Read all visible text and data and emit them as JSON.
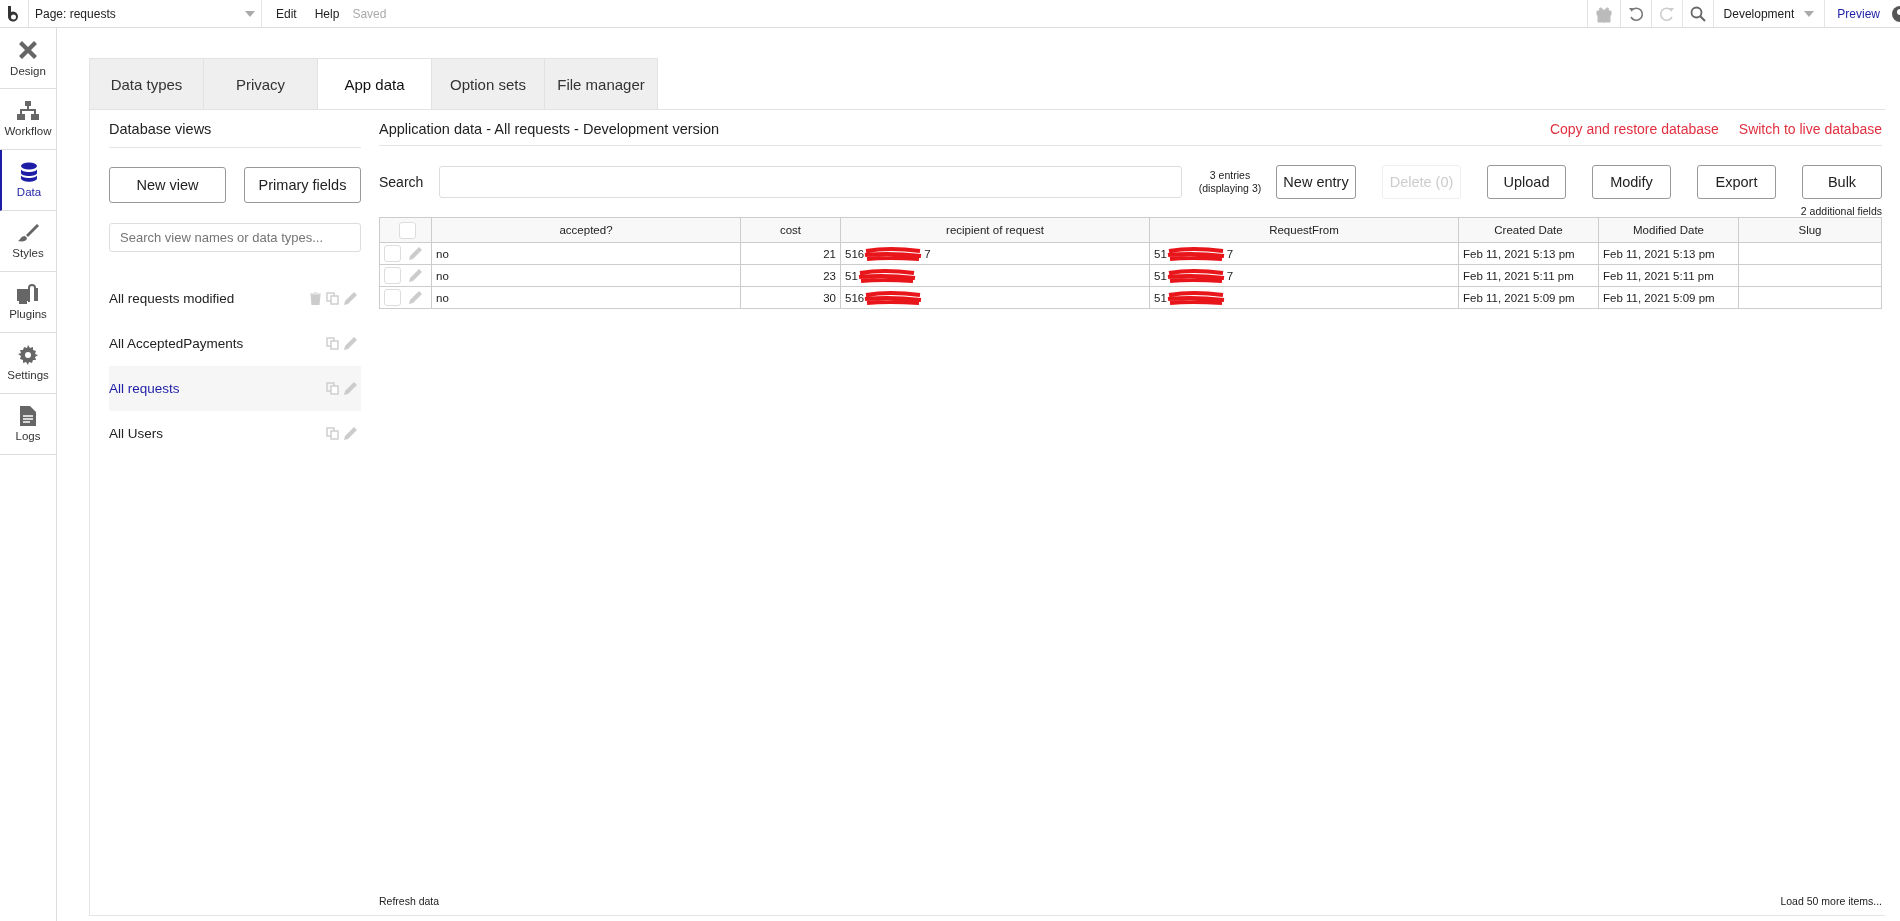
{
  "topbar": {
    "page": "Page: requests",
    "menu": [
      "Edit",
      "Help"
    ],
    "status": "Saved",
    "env": "Development",
    "preview": "Preview"
  },
  "sidebar": {
    "items": [
      {
        "label": "Design",
        "selected": false
      },
      {
        "label": "Workflow",
        "selected": false
      },
      {
        "label": "Data",
        "selected": true
      },
      {
        "label": "Styles",
        "selected": false
      },
      {
        "label": "Plugins",
        "selected": false
      },
      {
        "label": "Settings",
        "selected": false
      },
      {
        "label": "Logs",
        "selected": false
      }
    ]
  },
  "tabs": [
    {
      "label": "Data types",
      "selected": false
    },
    {
      "label": "Privacy",
      "selected": false
    },
    {
      "label": "App data",
      "selected": true
    },
    {
      "label": "Option sets",
      "selected": false
    },
    {
      "label": "File manager",
      "selected": false
    }
  ],
  "views": {
    "title": "Database views",
    "buttons": [
      "New view",
      "Primary fields"
    ],
    "search_placeholder": "Search view names or data types...",
    "items": [
      {
        "label": "All requests modified",
        "selected": false,
        "deletable": true
      },
      {
        "label": "All AcceptedPayments",
        "selected": false,
        "deletable": false
      },
      {
        "label": "All requests",
        "selected": true,
        "deletable": false
      },
      {
        "label": "All Users",
        "selected": false,
        "deletable": false
      }
    ]
  },
  "data": {
    "title": "Application data - All requests - Development version",
    "links": [
      "Copy and restore database",
      "Switch to live database"
    ],
    "search_label": "Search",
    "entries": [
      "3 entries",
      "(displaying 3)"
    ],
    "buttons": [
      {
        "label": "New entry",
        "disabled": false
      },
      {
        "label": "Delete (0)",
        "disabled": true
      },
      {
        "label": "Upload",
        "disabled": false
      },
      {
        "label": "Modify",
        "disabled": false
      },
      {
        "label": "Export",
        "disabled": false
      },
      {
        "label": "Bulk",
        "disabled": false
      }
    ],
    "additional": "2 additional fields",
    "select_all_checked": false,
    "columns": [
      "accepted?",
      "cost",
      "recipient of request",
      "RequestFrom",
      "Created Date",
      "Modified Date",
      "Slug"
    ],
    "rows": [
      {
        "checked": false,
        "accepted": "no",
        "cost": "21",
        "recipient": {
          "start": "516",
          "end": "7"
        },
        "from": {
          "start": "51",
          "end": "7"
        },
        "created": "Feb 11, 2021 5:13 pm",
        "modified": "Feb 11, 2021 5:13 pm"
      },
      {
        "checked": false,
        "accepted": "no",
        "cost": "23",
        "recipient": {
          "start": "51"
        },
        "from": {
          "start": "51",
          "end": "7"
        },
        "created": "Feb 11, 2021 5:11 pm",
        "modified": "Feb 11, 2021 5:11 pm"
      },
      {
        "checked": false,
        "accepted": "no",
        "cost": "30",
        "recipient": {
          "start": "516"
        },
        "from": {
          "start": "51"
        },
        "created": "Feb 11, 2021 5:09 pm",
        "modified": "Feb 11, 2021 5:09 pm"
      }
    ],
    "refresh": "Refresh data",
    "load_more": "Load 50 more items..."
  }
}
